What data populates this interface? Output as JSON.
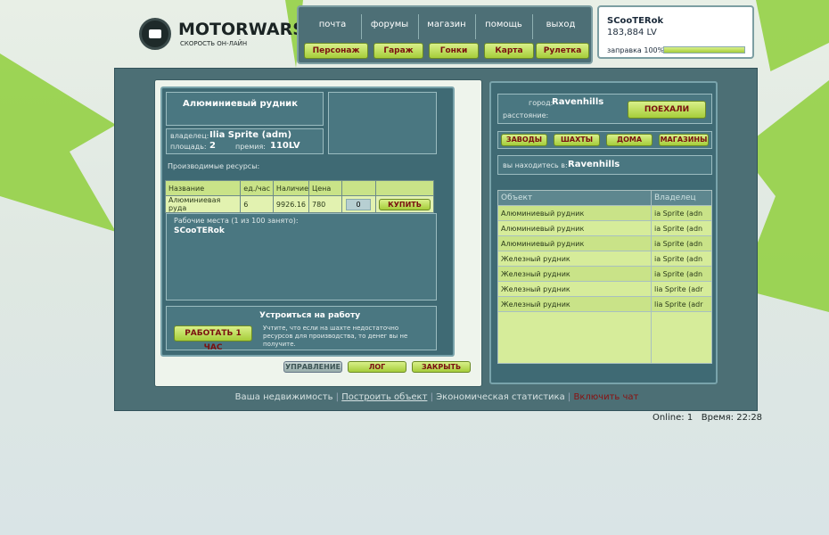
{
  "logo": {
    "name": "MOTORWARS.RU",
    "slogan": "СКОРОСТЬ ОН-ЛАЙН"
  },
  "topnav": {
    "links": [
      "почта",
      "форумы",
      "магазин",
      "помощь",
      "выход"
    ],
    "buttons": [
      "Персонаж",
      "Гараж",
      "Гонки",
      "Карта",
      "Рулетка"
    ]
  },
  "user": {
    "name": "SCooTERok",
    "money": "183,884 LV",
    "fuel_label": "заправка 100%",
    "fuel_percent": 100
  },
  "building": {
    "title": "Алюминиевый рудник",
    "owner_label": "владелец:",
    "owner": "Ilia Sprite (adm)",
    "area_label": "площадь:",
    "area": "2",
    "premium_label": "премия:",
    "premium": "110LV",
    "resources_label": "Производимые ресурсы:",
    "table_headers": [
      "Название",
      "ед./час",
      "Наличие",
      "Цена",
      "",
      ""
    ],
    "row": {
      "name": "Алюминиевая руда",
      "per_hour": "6",
      "stock": "9926.16",
      "price": "780",
      "qty": "0",
      "buy": "КУПИТЬ"
    },
    "workplaces_label": "Рабочие места (1 из 100 занято):",
    "worker": "SCooTERok",
    "job_title": "Устроиться на работу",
    "job_button": "РАБОТАТЬ 1 ЧАС",
    "job_note": "Учтите, что если на шахте недостаточно ресурсов для производства, то денег вы не получите."
  },
  "bottom_buttons": [
    "УПРАВЛЕНИЕ",
    "ЛОГ",
    "ЗАКРЫТЬ"
  ],
  "travel": {
    "city_label": "город:",
    "city": "Ravenhills",
    "distance_label": "расстояние:",
    "go": "ПОЕХАЛИ"
  },
  "filters": [
    "ЗАВОДЫ",
    "ШАХТЫ",
    "ДОМА",
    "МАГАЗИНЫ"
  ],
  "location": {
    "label": "вы находитесь в:",
    "city": "Ravenhills"
  },
  "objects": {
    "headers": [
      "Объект",
      "Владелец"
    ],
    "rows": [
      [
        "Алюминиевый рудник",
        "ia Sprite (adn"
      ],
      [
        "Алюминиевый рудник",
        "ia Sprite (adn"
      ],
      [
        "Алюминиевый рудник",
        "ia Sprite (adn"
      ],
      [
        "Железный рудник",
        "ia Sprite (adn"
      ],
      [
        "Железный рудник",
        "ia Sprite (adn"
      ],
      [
        "Железный рудник",
        "lia Sprite (adr"
      ],
      [
        "Железный рудник",
        "lia Sprite (adr"
      ]
    ]
  },
  "bottom_links": [
    "Ваша недвижимость",
    "Построить объект",
    "Экономическая статистика",
    "Включить чат"
  ],
  "status": {
    "online_label": "Online:",
    "online": "1",
    "time_label": "Время:",
    "time": "22:28"
  }
}
